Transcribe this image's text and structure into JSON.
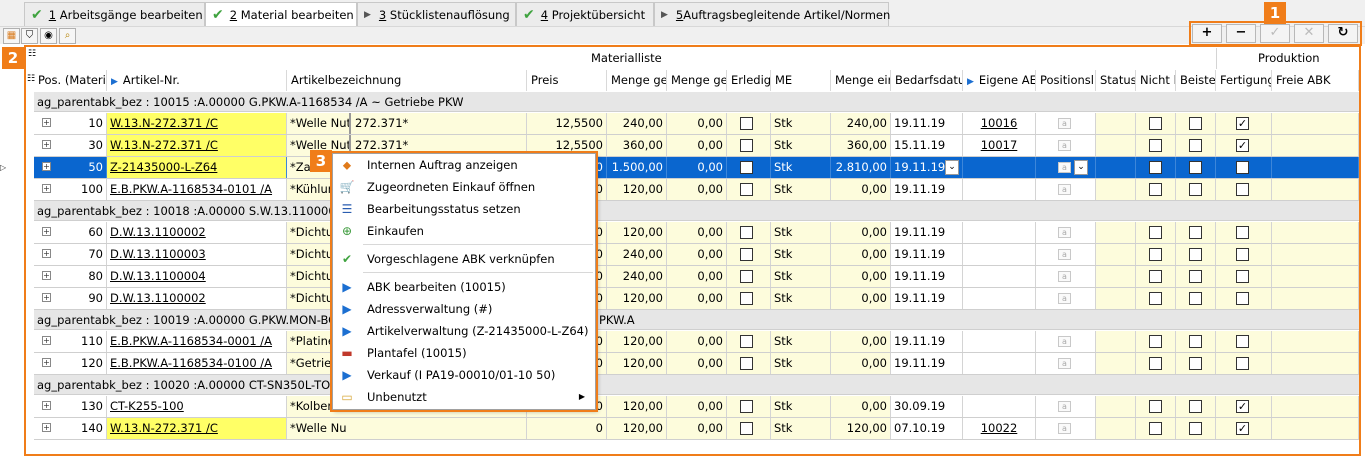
{
  "tabs": [
    {
      "num": "1",
      "label": "Arbeitsgänge bearbeiten",
      "status": "done"
    },
    {
      "num": "2",
      "label": "Material bearbeiten",
      "status": "done"
    },
    {
      "num": "3",
      "label": "Stücklistenauflösung",
      "status": "pending"
    },
    {
      "num": "4",
      "label": "Projektübersicht",
      "status": "done"
    },
    {
      "num": "5",
      "label": "Auftragsbegleitende Artikel/Normen",
      "status": "pending"
    }
  ],
  "toolbar": {
    "add": "+",
    "remove": "−",
    "confirm": "✓",
    "cancel": "✕",
    "refresh": "↻"
  },
  "callouts": {
    "c1": "1",
    "c2": "2",
    "c3": "3"
  },
  "grid": {
    "group_header": "Materialliste",
    "group_header_right": "Produktion",
    "columns": [
      "Pos. (Materi",
      "Artikel-Nr.",
      "Artikelbezeichnung",
      "Preis",
      "Menge ge",
      "Menge ge",
      "Erledig",
      "ME",
      "Menge eir",
      "Bedarfsdatu",
      "Eigene AE",
      "Positionsl",
      "Status",
      "Nicht l",
      "Beiste",
      "Fertigung",
      "Freie ABK"
    ],
    "groups": [
      {
        "label": "ag_parentabk_bez :  10015 :A.00000 G.PKW.A-1168534 /A ~ Getriebe PKW",
        "rows": [
          {
            "pos": "10",
            "artikel": "W.13.N-272.371 /C",
            "bez1": "*Welle Nut",
            "bez2": "272.371*",
            "preis": "12,5500",
            "menge1": "240,00",
            "menge2": "0,00",
            "erledigt": false,
            "me": "Stk",
            "menge3": "240,00",
            "datum": "19.11.19",
            "eigene": "10016",
            "fert": true,
            "hl": true
          },
          {
            "pos": "30",
            "artikel": "W.13.N-272.371 /C",
            "bez1": "*Welle Nut",
            "bez2": "272.371*",
            "preis": "12,5500",
            "menge1": "360,00",
            "menge2": "0,00",
            "erledigt": false,
            "me": "Stk",
            "menge3": "360,00",
            "datum": "15.11.19",
            "eigene": "10017",
            "fert": true,
            "hl": true
          },
          {
            "pos": "50",
            "artikel": "Z-21435000-L-Z64",
            "bez1": "*Za",
            "bez2": "",
            "preis": "0",
            "menge1": "1.500,00",
            "menge2": "0,00",
            "erledigt": false,
            "me": "Stk",
            "menge3": "2.810,00",
            "datum": "19.11.19",
            "eigene": "",
            "fert": false,
            "hl": true,
            "selected": true
          },
          {
            "pos": "100",
            "artikel": "E.B.PKW.A-1168534-0101 /A",
            "bez1": "*Kühlung",
            "bez2": "",
            "preis": "0",
            "menge1": "120,00",
            "menge2": "0,00",
            "erledigt": false,
            "me": "Stk",
            "menge3": "0,00",
            "datum": "19.11.19",
            "eigene": "",
            "fert": false,
            "hl": false
          }
        ]
      },
      {
        "label": "ag_parentabk_bez :  10018 :A.00000 S.W.13.1100001",
        "rows": [
          {
            "pos": "60",
            "artikel": "D.W.13.1100002",
            "bez1": "*Dichtung",
            "bez2": "",
            "preis": "0",
            "menge1": "120,00",
            "menge2": "0,00",
            "erledigt": false,
            "me": "Stk",
            "menge3": "0,00",
            "datum": "19.11.19",
            "eigene": "",
            "fert": false,
            "hl": false
          },
          {
            "pos": "70",
            "artikel": "D.W.13.1100003",
            "bez1": "*Dichtung",
            "bez2": "",
            "preis": "0",
            "menge1": "240,00",
            "menge2": "0,00",
            "erledigt": false,
            "me": "Stk",
            "menge3": "0,00",
            "datum": "19.11.19",
            "eigene": "",
            "fert": false,
            "hl": false
          },
          {
            "pos": "80",
            "artikel": "D.W.13.1100004",
            "bez1": "*Dichtung",
            "bez2": "",
            "preis": "0",
            "menge1": "240,00",
            "menge2": "0,00",
            "erledigt": false,
            "me": "Stk",
            "menge3": "0,00",
            "datum": "19.11.19",
            "eigene": "",
            "fert": false,
            "hl": false
          },
          {
            "pos": "90",
            "artikel": "D.W.13.1100002",
            "bez1": "*Dichtung",
            "bez2": "",
            "preis": "0",
            "menge1": "120,00",
            "menge2": "0,00",
            "erledigt": false,
            "me": "Stk",
            "menge3": "0,00",
            "datum": "19.11.19",
            "eigene": "",
            "fert": false,
            "hl": false
          }
        ]
      },
      {
        "label": "ag_parentabk_bez :  10019 :A.00000 G.PKW.MON-BC",
        "label_tail": "PKW.A",
        "rows": [
          {
            "pos": "110",
            "artikel": "E.B.PKW.A-1168534-0001 /A",
            "bez1": "*Platine A",
            "bez2": "",
            "preis": "0",
            "menge1": "120,00",
            "menge2": "0,00",
            "erledigt": false,
            "me": "Stk",
            "menge3": "0,00",
            "datum": "19.11.19",
            "eigene": "",
            "fert": false,
            "hl": false
          },
          {
            "pos": "120",
            "artikel": "E.B.PKW.A-1168534-0100 /A",
            "bez1": "*Getriebe",
            "bez2": "",
            "preis": "0",
            "menge1": "120,00",
            "menge2": "0,00",
            "erledigt": false,
            "me": "Stk",
            "menge3": "0,00",
            "datum": "19.11.19",
            "eigene": "",
            "fert": false,
            "hl": false
          }
        ]
      },
      {
        "label": "ag_parentabk_bez :  10020 :A.00000 CT-SN350L-TOF",
        "rows": [
          {
            "pos": "130",
            "artikel": "CT-K255-100",
            "bez1": "*Kolben*",
            "bez2": "",
            "preis": "0",
            "menge1": "120,00",
            "menge2": "0,00",
            "erledigt": false,
            "me": "Stk",
            "menge3": "0,00",
            "datum": "30.09.19",
            "eigene": "",
            "fert": true,
            "hl": false
          },
          {
            "pos": "140",
            "artikel": "W.13.N-272.371 /C",
            "bez1": "*Welle Nu",
            "bez2": "",
            "preis": "0",
            "menge1": "120,00",
            "menge2": "0,00",
            "erledigt": false,
            "me": "Stk",
            "menge3": "120,00",
            "datum": "07.10.19",
            "eigene": "10022",
            "fert": true,
            "hl": true
          }
        ]
      }
    ]
  },
  "context_menu": [
    {
      "label": "Internen Auftrag anzeigen",
      "icon": "internal-order-icon"
    },
    {
      "label": "Zugeordneten Einkauf öffnen",
      "icon": "purchase-cart-icon"
    },
    {
      "label": "Bearbeitungsstatus setzen",
      "icon": "status-list-icon"
    },
    {
      "label": "Einkaufen",
      "icon": "buy-cart-icon",
      "sep_after": true
    },
    {
      "label": "Vorgeschlagene ABK verknüpfen",
      "icon": "check-link-icon",
      "sep_after": true
    },
    {
      "label": "ABK bearbeiten  (10015)",
      "icon": "arrow-right-icon"
    },
    {
      "label": "Adressverwaltung  (#)",
      "icon": "arrow-right-icon"
    },
    {
      "label": "Artikelverwaltung  (Z-21435000-L-Z64)",
      "icon": "arrow-right-icon"
    },
    {
      "label": "Plantafel  (10015)",
      "icon": "planboard-icon"
    },
    {
      "label": "Verkauf  (I PA19-00010/01-10 50)",
      "icon": "arrow-right-icon"
    },
    {
      "label": "Unbenutzt",
      "icon": "folder-icon",
      "submenu": true
    }
  ],
  "colors": {
    "accent": "#f07d19",
    "selection": "#0a66cf",
    "highlight": "#ffff66",
    "check": "#3fa33f"
  }
}
